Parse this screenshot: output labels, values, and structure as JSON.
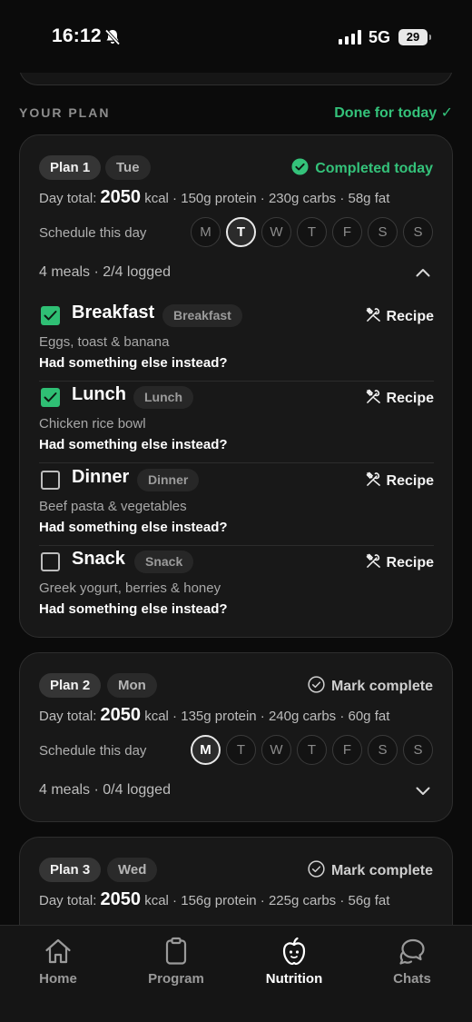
{
  "status_bar": {
    "time": "16:12",
    "network": "5G",
    "battery": "29"
  },
  "section": {
    "title": "YOUR PLAN",
    "done_label": "Done for today ✓"
  },
  "plans": [
    {
      "plan_label": "Plan 1",
      "day_label": "Tue",
      "status": "Completed today",
      "day_total_label": "Day total:",
      "kcal": "2050",
      "macros": "kcal · 150g protein · 230g carbs · 58g fat",
      "schedule_label": "Schedule this day",
      "weekdays": [
        "M",
        "T",
        "W",
        "T",
        "F",
        "S",
        "S"
      ],
      "active_day_index": 1,
      "meals_summary": "4 meals · 2/4 logged",
      "expanded": true,
      "meals": [
        {
          "name": "Breakfast",
          "tag": "Breakfast",
          "desc": "Eggs, toast & banana",
          "else": "Had something else instead?",
          "recipe": "Recipe",
          "checked": true
        },
        {
          "name": "Lunch",
          "tag": "Lunch",
          "desc": "Chicken rice bowl",
          "else": "Had something else instead?",
          "recipe": "Recipe",
          "checked": true
        },
        {
          "name": "Dinner",
          "tag": "Dinner",
          "desc": "Beef pasta & vegetables",
          "else": "Had something else instead?",
          "recipe": "Recipe",
          "checked": false
        },
        {
          "name": "Snack",
          "tag": "Snack",
          "desc": "Greek yogurt, berries & honey",
          "else": "Had something else instead?",
          "recipe": "Recipe",
          "checked": false
        }
      ]
    },
    {
      "plan_label": "Plan 2",
      "day_label": "Mon",
      "status": "Mark complete",
      "day_total_label": "Day total:",
      "kcal": "2050",
      "macros": "kcal · 135g protein · 240g carbs · 60g fat",
      "schedule_label": "Schedule this day",
      "weekdays": [
        "M",
        "T",
        "W",
        "T",
        "F",
        "S",
        "S"
      ],
      "active_day_index": 0,
      "meals_summary": "4 meals · 0/4 logged",
      "expanded": false
    },
    {
      "plan_label": "Plan 3",
      "day_label": "Wed",
      "status": "Mark complete",
      "day_total_label": "Day total:",
      "kcal": "2050",
      "macros": "kcal · 156g protein · 225g carbs · 56g fat"
    }
  ],
  "tabs": [
    {
      "label": "Home",
      "icon": "home-icon",
      "active": false
    },
    {
      "label": "Program",
      "icon": "clipboard-icon",
      "active": false
    },
    {
      "label": "Nutrition",
      "icon": "apple-icon",
      "active": true
    },
    {
      "label": "Chats",
      "icon": "chat-bubbles-icon",
      "active": false
    }
  ],
  "colors": {
    "accent": "#34c27a",
    "background": "#0b0b0b",
    "card": "#181818"
  }
}
